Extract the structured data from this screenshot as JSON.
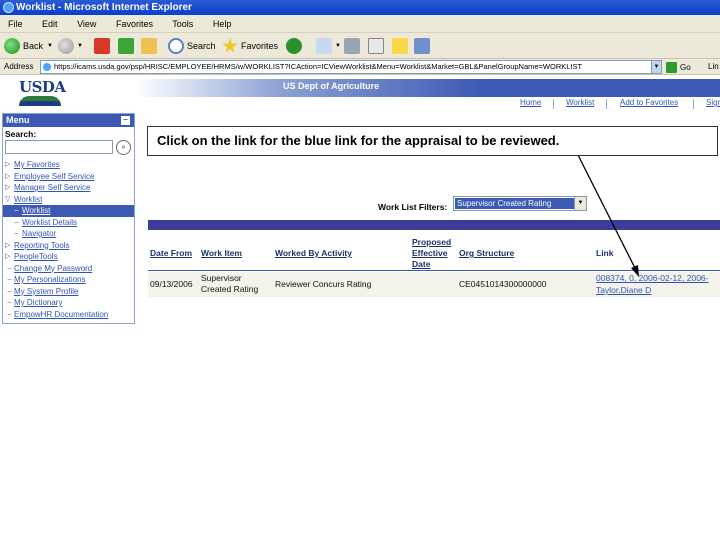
{
  "window": {
    "title": "Worklist - Microsoft Internet Explorer"
  },
  "menubar": [
    "File",
    "Edit",
    "View",
    "Favorites",
    "Tools",
    "Help"
  ],
  "toolbar": {
    "back": "Back",
    "search": "Search",
    "favorites": "Favorites"
  },
  "address": {
    "label": "Address",
    "url": "https://icams.usda.gov/psp/HRISC/EMPLOYEE/HRMS/w/WORKLIST?ICAction=ICViewWorklist&Menu=Worklist&Market=GBL&PanelGroupName=WORKLIST",
    "go": "Go",
    "links": "Lin"
  },
  "header": {
    "logo": "USDA",
    "banner": "US Dept of Agriculture",
    "links": [
      "Home",
      "Worklist",
      "Add to Favorites",
      "Sign"
    ]
  },
  "menu": {
    "title": "Menu",
    "search_label": "Search:",
    "items": [
      {
        "label": "My Favorites"
      },
      {
        "label": "Employee Self Service"
      },
      {
        "label": "Manager Self Service"
      },
      {
        "label": "Worklist"
      },
      {
        "label": "Worklist"
      },
      {
        "label": "Worklist Details"
      },
      {
        "label": "Navigator"
      },
      {
        "label": "Reporting Tools"
      },
      {
        "label": "PeopleTools"
      },
      {
        "label": "Change My Password"
      },
      {
        "label": "My Personalizations"
      },
      {
        "label": "My System Profile"
      },
      {
        "label": "My Dictionary"
      },
      {
        "label": "EmpowHR Documentation"
      }
    ]
  },
  "callout": "Click on the link for the blue link for the appraisal to be reviewed.",
  "filter": {
    "label": "Work List Filters:",
    "value": "Supervisor Created Rating"
  },
  "grid": {
    "headers": [
      "Date From",
      "Work Item",
      "Worked By Activity",
      "Proposed Effective Date",
      "Org Structure",
      "Link"
    ],
    "rows": [
      {
        "date_from": "09/13/2006",
        "work_item": "Supervisor Created Rating",
        "activity": "Reviewer Concurs Rating",
        "proposed_date": "",
        "org": "CE0451014300000000",
        "link_line1": "008374, 0, 2006-02-12, 2006-",
        "link_line2": "Taylor,Diane D"
      }
    ]
  }
}
